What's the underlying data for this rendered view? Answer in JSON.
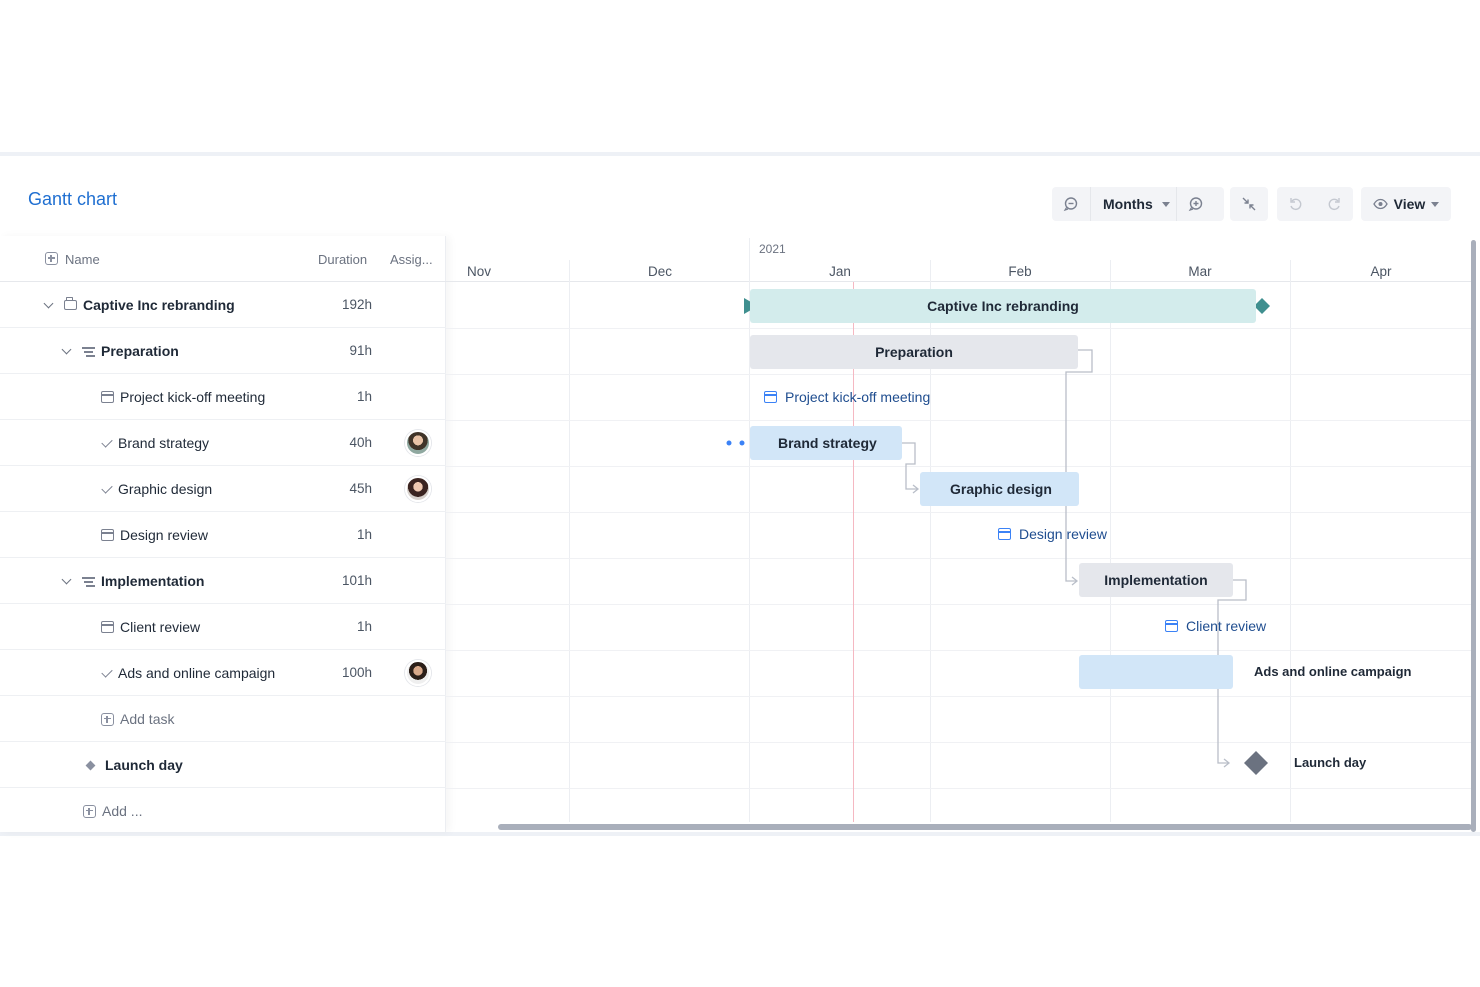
{
  "app": {
    "title": "Gantt chart"
  },
  "toolbar": {
    "zoom_out_icon": "zoom-out-icon",
    "zoom_level": "Months",
    "zoom_in_icon": "zoom-in-icon",
    "collapse_icon": "collapse-arrows-icon",
    "undo_icon": "undo-icon",
    "redo_icon": "redo-icon",
    "view_label": "View",
    "view_icon": "eye-icon"
  },
  "grid": {
    "columns": {
      "name": "Name",
      "duration": "Duration",
      "assignee": "Assig..."
    },
    "rows": [
      {
        "name": "Captive Inc rebranding",
        "duration": "192h",
        "type": "project",
        "icon": "briefcase-icon"
      },
      {
        "name": "Preparation",
        "duration": "91h",
        "type": "phase",
        "icon": "phase-icon"
      },
      {
        "name": "Project kick-off meeting",
        "duration": "1h",
        "type": "meeting",
        "icon": "calendar-icon"
      },
      {
        "name": "Brand strategy",
        "duration": "40h",
        "type": "task",
        "icon": "task-check-icon",
        "assignee": "avatar-woman-1"
      },
      {
        "name": "Graphic design",
        "duration": "45h",
        "type": "task",
        "icon": "task-check-icon",
        "assignee": "avatar-woman-2"
      },
      {
        "name": "Design review",
        "duration": "1h",
        "type": "meeting",
        "icon": "calendar-icon"
      },
      {
        "name": "Implementation",
        "duration": "101h",
        "type": "phase",
        "icon": "phase-icon"
      },
      {
        "name": "Client review",
        "duration": "1h",
        "type": "meeting",
        "icon": "calendar-icon"
      },
      {
        "name": "Ads and online campaign",
        "duration": "100h",
        "type": "task",
        "icon": "task-check-icon",
        "assignee": "avatar-man-1"
      },
      {
        "name": "Add task",
        "duration": "",
        "type": "add"
      },
      {
        "name": "Launch day",
        "duration": "",
        "type": "milestone",
        "icon": "diamond-icon"
      },
      {
        "name": "Add ...",
        "duration": "",
        "type": "add"
      }
    ]
  },
  "timeline": {
    "year": "2021",
    "months": [
      "Nov",
      "Dec",
      "Jan",
      "Feb",
      "Mar",
      "Apr"
    ],
    "bars": {
      "project": "Captive Inc rebranding",
      "preparation": "Preparation",
      "kickoff": "Project kick-off meeting",
      "brand": "Brand strategy",
      "graphic": "Graphic design",
      "design_review": "Design review",
      "implementation": "Implementation",
      "client_review": "Client review",
      "ads": "Ads and online campaign",
      "launch": "Launch day"
    },
    "colors": {
      "project": "#d3ecec",
      "phase": "#e5e7ec",
      "task": "#d2e6f8",
      "milestone": "#6b7280",
      "today": "#f5b8c2",
      "accent": "#1f6fd1"
    }
  }
}
